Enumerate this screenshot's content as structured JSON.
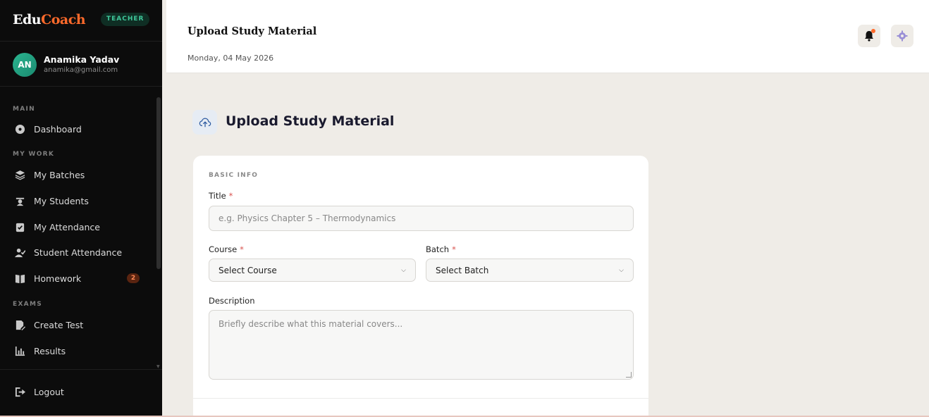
{
  "brand": {
    "part1": "Edu",
    "part2": "Coach",
    "role": "TEACHER"
  },
  "user": {
    "initials": "AN",
    "name": "Anamika Yadav",
    "email": "anamika@gmail.com"
  },
  "sidebar": {
    "sections": {
      "main": "MAIN",
      "my_work": "MY WORK",
      "exams": "EXAMS"
    },
    "items": [
      {
        "label": "Dashboard",
        "icon": "dashboard-icon"
      },
      {
        "label": "My Batches",
        "icon": "layers-icon"
      },
      {
        "label": "My Students",
        "icon": "graduate-icon"
      },
      {
        "label": "My Attendance",
        "icon": "clipboard-check-icon"
      },
      {
        "label": "Student Attendance",
        "icon": "user-check-icon"
      },
      {
        "label": "Homework",
        "icon": "book-icon",
        "badge": "2"
      },
      {
        "label": "Create Test",
        "icon": "file-edit-icon"
      },
      {
        "label": "Results",
        "icon": "bar-chart-icon"
      }
    ],
    "logout": "Logout"
  },
  "header": {
    "title": "Upload Study Material",
    "date": "Monday, 04 May 2026"
  },
  "main": {
    "heading": "Upload Study Material",
    "section_label": "BASIC INFO",
    "title_label": "Title",
    "title_placeholder": "e.g. Physics Chapter 5 – Thermodynamics",
    "course_label": "Course",
    "course_value": "Select Course",
    "batch_label": "Batch",
    "batch_value": "Select Batch",
    "description_label": "Description",
    "description_placeholder": "Briefly describe what this material covers...",
    "required_mark": "*"
  },
  "colors": {
    "accent": "#ff6a2b",
    "sidebar_bg": "#0c0c0c",
    "teal": "#2bb590",
    "page_bg": "#efece7"
  }
}
